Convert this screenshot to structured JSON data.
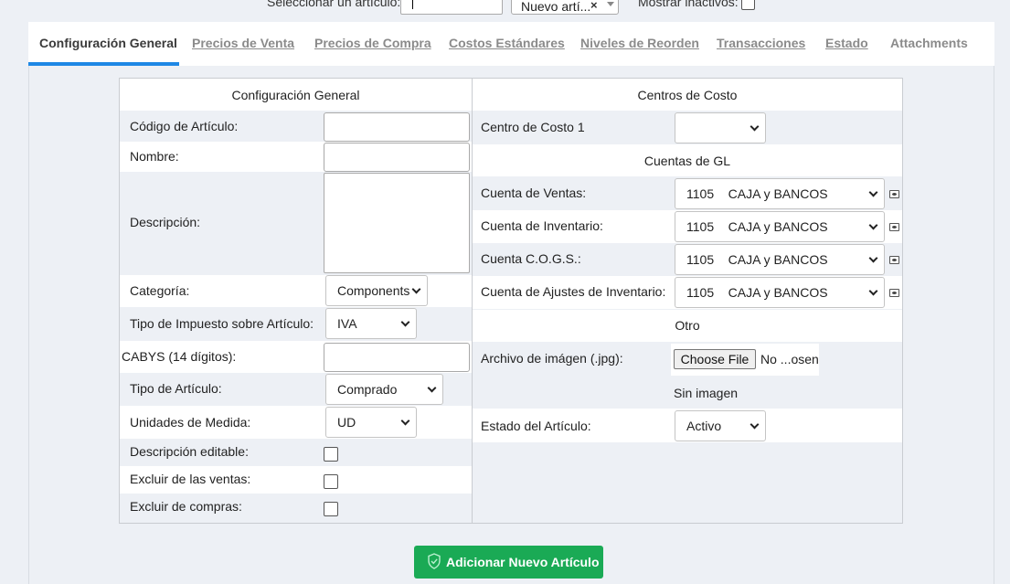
{
  "top": {
    "select_item_label": "Seleccionar un artículo:",
    "item_select_value": "Nuevo artí...",
    "clear_icon": "close-icon",
    "show_inactive_label": "Mostrar inactivos:"
  },
  "tabs": [
    {
      "label": "Configuración General",
      "active": true
    },
    {
      "label": "Precios de Venta"
    },
    {
      "label": "Precios de Compra"
    },
    {
      "label": "Costos Estándares"
    },
    {
      "label": "Niveles de Reorden"
    },
    {
      "label": "Transacciones"
    },
    {
      "label": "Estado"
    },
    {
      "label": "Attachments"
    }
  ],
  "left": {
    "header": "Configuración General",
    "item_code_label": "Código de Artículo:",
    "name_label": "Nombre:",
    "description_label": "Descripción:",
    "category_label": "Categoría:",
    "category_value": "Components",
    "tax_type_label": "Tipo de Impuesto sobre Artículo:",
    "tax_type_value": "IVA",
    "cabys_label": "CABYS (14 dígitos):",
    "item_type_label": "Tipo de Artículo:",
    "item_type_value": "Comprado",
    "units_label": "Unidades de Medida:",
    "units_value": "UD",
    "editable_desc_label": "Descripción editable:",
    "exclude_sales_label": "Excluir de las ventas:",
    "exclude_purchases_label": "Excluir de compras:"
  },
  "right": {
    "cost_centers_header": "Centros de Costo",
    "cost_center_1_label": "Centro de Costo 1",
    "cost_center_1_value": "",
    "gl_header": "Cuentas de GL",
    "sales_account_label": "Cuenta de Ventas:",
    "sales_account_value": "1105    CAJA y BANCOS",
    "inventory_account_label": "Cuenta de Inventario:",
    "inventory_account_value": "1105    CAJA y BANCOS",
    "cogs_account_label": "Cuenta C.O.G.S.:",
    "cogs_account_value": "1105    CAJA y BANCOS",
    "adjust_account_label": "Cuenta de Ajustes de Inventario:",
    "adjust_account_value": "1105    CAJA y BANCOS",
    "other_header": "Otro",
    "image_file_label": "Archivo de imágen (.jpg):",
    "choose_file_label": "Choose File",
    "file_status": "No ...osen",
    "no_image_text": "Sin imagen",
    "item_status_label": "Estado del Artículo:",
    "item_status_value": "Activo"
  },
  "submit_label": "Adicionar Nuevo Artículo",
  "colors": {
    "accent_tab": "#1e88e5",
    "submit_green": "#1aaa55",
    "background": "#edf0f5"
  }
}
